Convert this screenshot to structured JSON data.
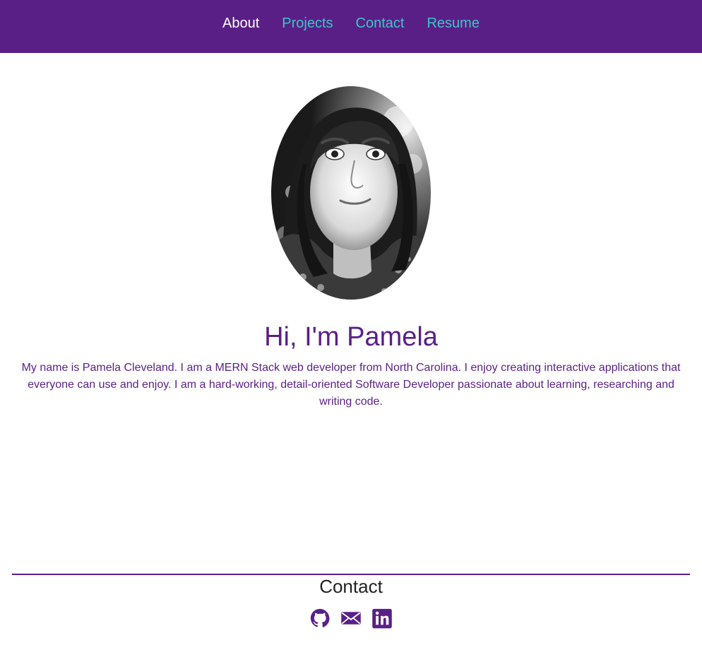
{
  "nav": {
    "items": [
      {
        "label": "About",
        "active": true
      },
      {
        "label": "Projects",
        "active": false
      },
      {
        "label": "Contact",
        "active": false
      },
      {
        "label": "Resume",
        "active": false
      }
    ]
  },
  "hero": {
    "title": "Hi, I'm Pamela",
    "intro": "My name is Pamela Cleveland. I am a MERN Stack web developer from North Carolina. I enjoy creating interactive applications that everyone can use and enjoy. I am a hard-working, detail-oriented Software Developer passionate about learning, researching and writing code."
  },
  "footer": {
    "title": "Contact",
    "icons": [
      "github-icon",
      "email-icon",
      "linkedin-icon"
    ]
  },
  "colors": {
    "brand_purple": "#5a1f87",
    "nav_link_teal": "#3cc6c6",
    "nav_active": "#ffffff"
  }
}
